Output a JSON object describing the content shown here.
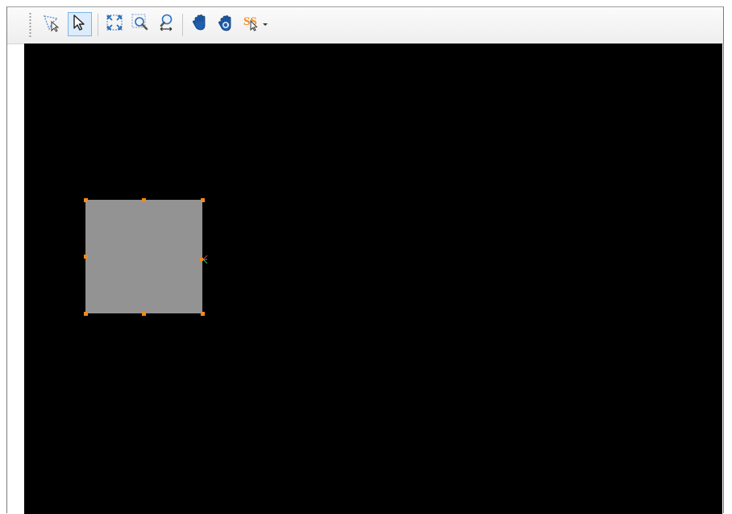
{
  "toolbar": {
    "tools": [
      {
        "id": "lasso-select",
        "icon": "lasso-select-icon",
        "active": false
      },
      {
        "id": "select",
        "icon": "arrow-pointer-icon",
        "active": true
      },
      {
        "id": "zoom-extents",
        "icon": "zoom-extents-icon",
        "active": false
      },
      {
        "id": "zoom-window",
        "icon": "zoom-window-icon",
        "active": false
      },
      {
        "id": "zoom-pan",
        "icon": "zoom-drag-icon",
        "active": false
      },
      {
        "id": "pan",
        "icon": "hand-icon",
        "active": false
      },
      {
        "id": "rotate-pan",
        "icon": "hand-rotate-icon",
        "active": false
      },
      {
        "id": "snap",
        "icon": "snap-icon",
        "active": false,
        "dropdown": true
      }
    ]
  },
  "canvas": {
    "background": "#000000",
    "selected_shape": {
      "type": "rectangle",
      "fill": "#939393",
      "handle_color": "#f08a1c",
      "handles": 8
    }
  }
}
